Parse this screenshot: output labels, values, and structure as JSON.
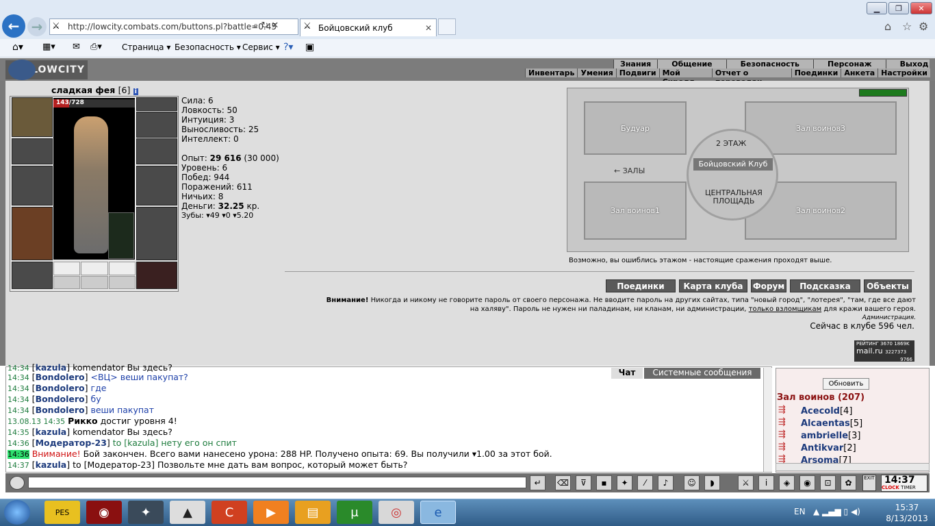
{
  "browser": {
    "url": "http://lowcity.combats.com/buttons.pl?battle=0.45",
    "tab_title": "Бойцовский клуб",
    "menu": [
      "Страница",
      "Безопасность",
      "Сервис"
    ]
  },
  "game": {
    "logo": "LOWCITY",
    "top_nav": [
      "Знания",
      "Общение",
      "Безопасность",
      "Персонаж",
      "Выход"
    ],
    "sub_nav": [
      "Инвентарь",
      "Умения",
      "Подвиги",
      "Мой Скролл",
      "Отчет о переводах",
      "Поединки",
      "Анкета",
      "Настройки"
    ],
    "character": {
      "name": "сладкая фея",
      "level": "[6]",
      "hp": "143/728",
      "stats": [
        "Сила: 6",
        "Ловкость: 50",
        "Интуиция: 3",
        "Выносливость: 25",
        "Интеллект: 0"
      ],
      "exp_label": "Опыт:",
      "exp_value": "29 616",
      "exp_next": "(30 000)",
      "info": [
        "Уровень: 6",
        "Побед: 944",
        "Поражений: 611",
        "Ничьих: 8"
      ],
      "money_label": "Деньги:",
      "money_value": "32.25",
      "money_unit": "кр.",
      "teeth": "Зубы: ▾49 ▾0 ▾5.20"
    },
    "map": {
      "rooms": [
        "Будуар",
        "Зал воинов3",
        "Зал воинов1",
        "Зал воинов2"
      ],
      "floor": "2 ЭТАЖ",
      "center": "Бойцовский Клуб",
      "left": "ЗАЛЫ",
      "square_1": "ЦЕНТРАЛЬНАЯ",
      "square_2": "ПЛОЩАДЬ",
      "note": "Возможно, вы ошиблись этажом - настоящие сражения проходят выше."
    },
    "buttons": [
      "Поединки",
      "Карта клуба",
      "Форум",
      "Подсказка",
      "Объекты"
    ],
    "warning_title": "Внимание!",
    "warning_text1": "Никогда и никому не говорите пароль от своего персонажа. Не вводите пароль на других сайтах, типа \"новый город\", \"лотерея\", \"там, где все дают",
    "warning_text2": "на халяву\". Пароль не нужен ни паладинам, ни кланам, ни администрации,",
    "warning_link": "только взломщикам",
    "warning_text3": "для кражи вашего героя.",
    "admin": "Администрация.",
    "online": "Сейчас в клубе 596 чел.",
    "rating": {
      "label": "РЕЙТИНГ",
      "n1": "3670",
      "n2": "1869K",
      "brand": "mail.ru",
      "n3": "3227373",
      "n4": "9766"
    }
  },
  "chat": {
    "tabs": [
      "Чат",
      "Системные сообщения"
    ],
    "lines": [
      {
        "t": "14:34",
        "n": "kazula",
        "m": "komendator Вы здесь?"
      },
      {
        "t": "14:34",
        "n": "Bondolero",
        "m": "<ВЦ> веши пакупат?"
      },
      {
        "t": "14:34",
        "n": "Bondolero",
        "m": "где"
      },
      {
        "t": "14:34",
        "n": "Bondolero",
        "m": "бу"
      },
      {
        "t": "14:34",
        "n": "Bondolero",
        "m": "веши пакупат"
      },
      {
        "t": "13.08.13 14:35",
        "n": "Рикко",
        "m": "достиг уровня 4!"
      },
      {
        "t": "14:35",
        "n": "kazula",
        "m": "komendator Вы здесь?"
      },
      {
        "t": "14:36",
        "n": "Модератор-23",
        "m": "to [kazula] нету его он спит"
      },
      {
        "t": "14:36",
        "n": "Внимание!",
        "m": "Бой закончен. Всего вами нанесено урона: 288 HP. Получено опыта: 69. Вы получили ▾1.00 за этот бой."
      },
      {
        "t": "14:37",
        "n": "kazula",
        "m": "to [Модератор-23] Позвольте мне дать вам вопрос, который может быть?"
      }
    ],
    "refresh": "Обновить",
    "room": "Зал воинов (207)",
    "players": [
      {
        "n": "Acecold",
        "l": "[4]"
      },
      {
        "n": "Alcaentas",
        "l": "[5]"
      },
      {
        "n": "ambrielle",
        "l": "[3]"
      },
      {
        "n": "Antikvar",
        "l": "[2]"
      },
      {
        "n": "Arsoma",
        "l": "[7]"
      }
    ]
  },
  "clock": {
    "time": "14:37",
    "label1": "CLOCK",
    "label2": "TIMER",
    "exit": "EXIT"
  },
  "taskbar": {
    "lang": "EN",
    "time": "15:37",
    "date": "8/13/2013"
  }
}
